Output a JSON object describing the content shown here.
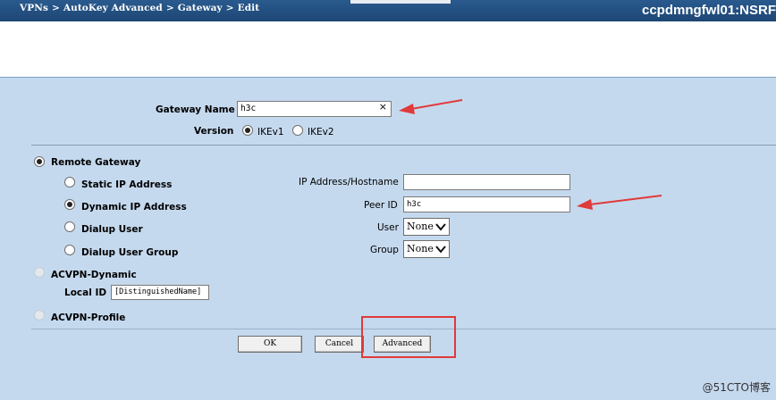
{
  "header": {
    "breadcrumb": [
      "VPNs",
      "AutoKey Advanced",
      "Gateway",
      "Edit"
    ],
    "separator": ">",
    "device_name": "ccpdmngfwl01:NSRF"
  },
  "form": {
    "gateway_name_label": "Gateway Name",
    "gateway_name_value": "h3c",
    "clear_glyph": "×",
    "version_label": "Version",
    "version_options": [
      "IKEv1",
      "IKEv2"
    ],
    "version_selected": "IKEv1",
    "remote_gateway_label": "Remote Gateway",
    "gateway_types": [
      "Static IP Address",
      "Dynamic IP Address",
      "Dialup User",
      "Dialup User Group"
    ],
    "gateway_type_selected": "Dynamic IP Address",
    "ip_hostname_label": "IP Address/Hostname",
    "ip_hostname_value": "",
    "peer_id_label": "Peer ID",
    "peer_id_value": "h3c",
    "user_label": "User",
    "user_value": "None",
    "group_label": "Group",
    "group_value": "None",
    "acvpn_dynamic_label": "ACVPN-Dynamic",
    "local_id_label": "Local ID",
    "local_id_value": "[DistinguishedName]",
    "acvpn_profile_label": "ACVPN-Profile"
  },
  "buttons": {
    "ok": "OK",
    "cancel": "Cancel",
    "advanced": "Advanced"
  },
  "watermark": "@51CTO博客",
  "colors": {
    "header_bg": "#1d4674",
    "page_bg": "#c5d9ee",
    "annotation_red": "#e03a3a"
  }
}
